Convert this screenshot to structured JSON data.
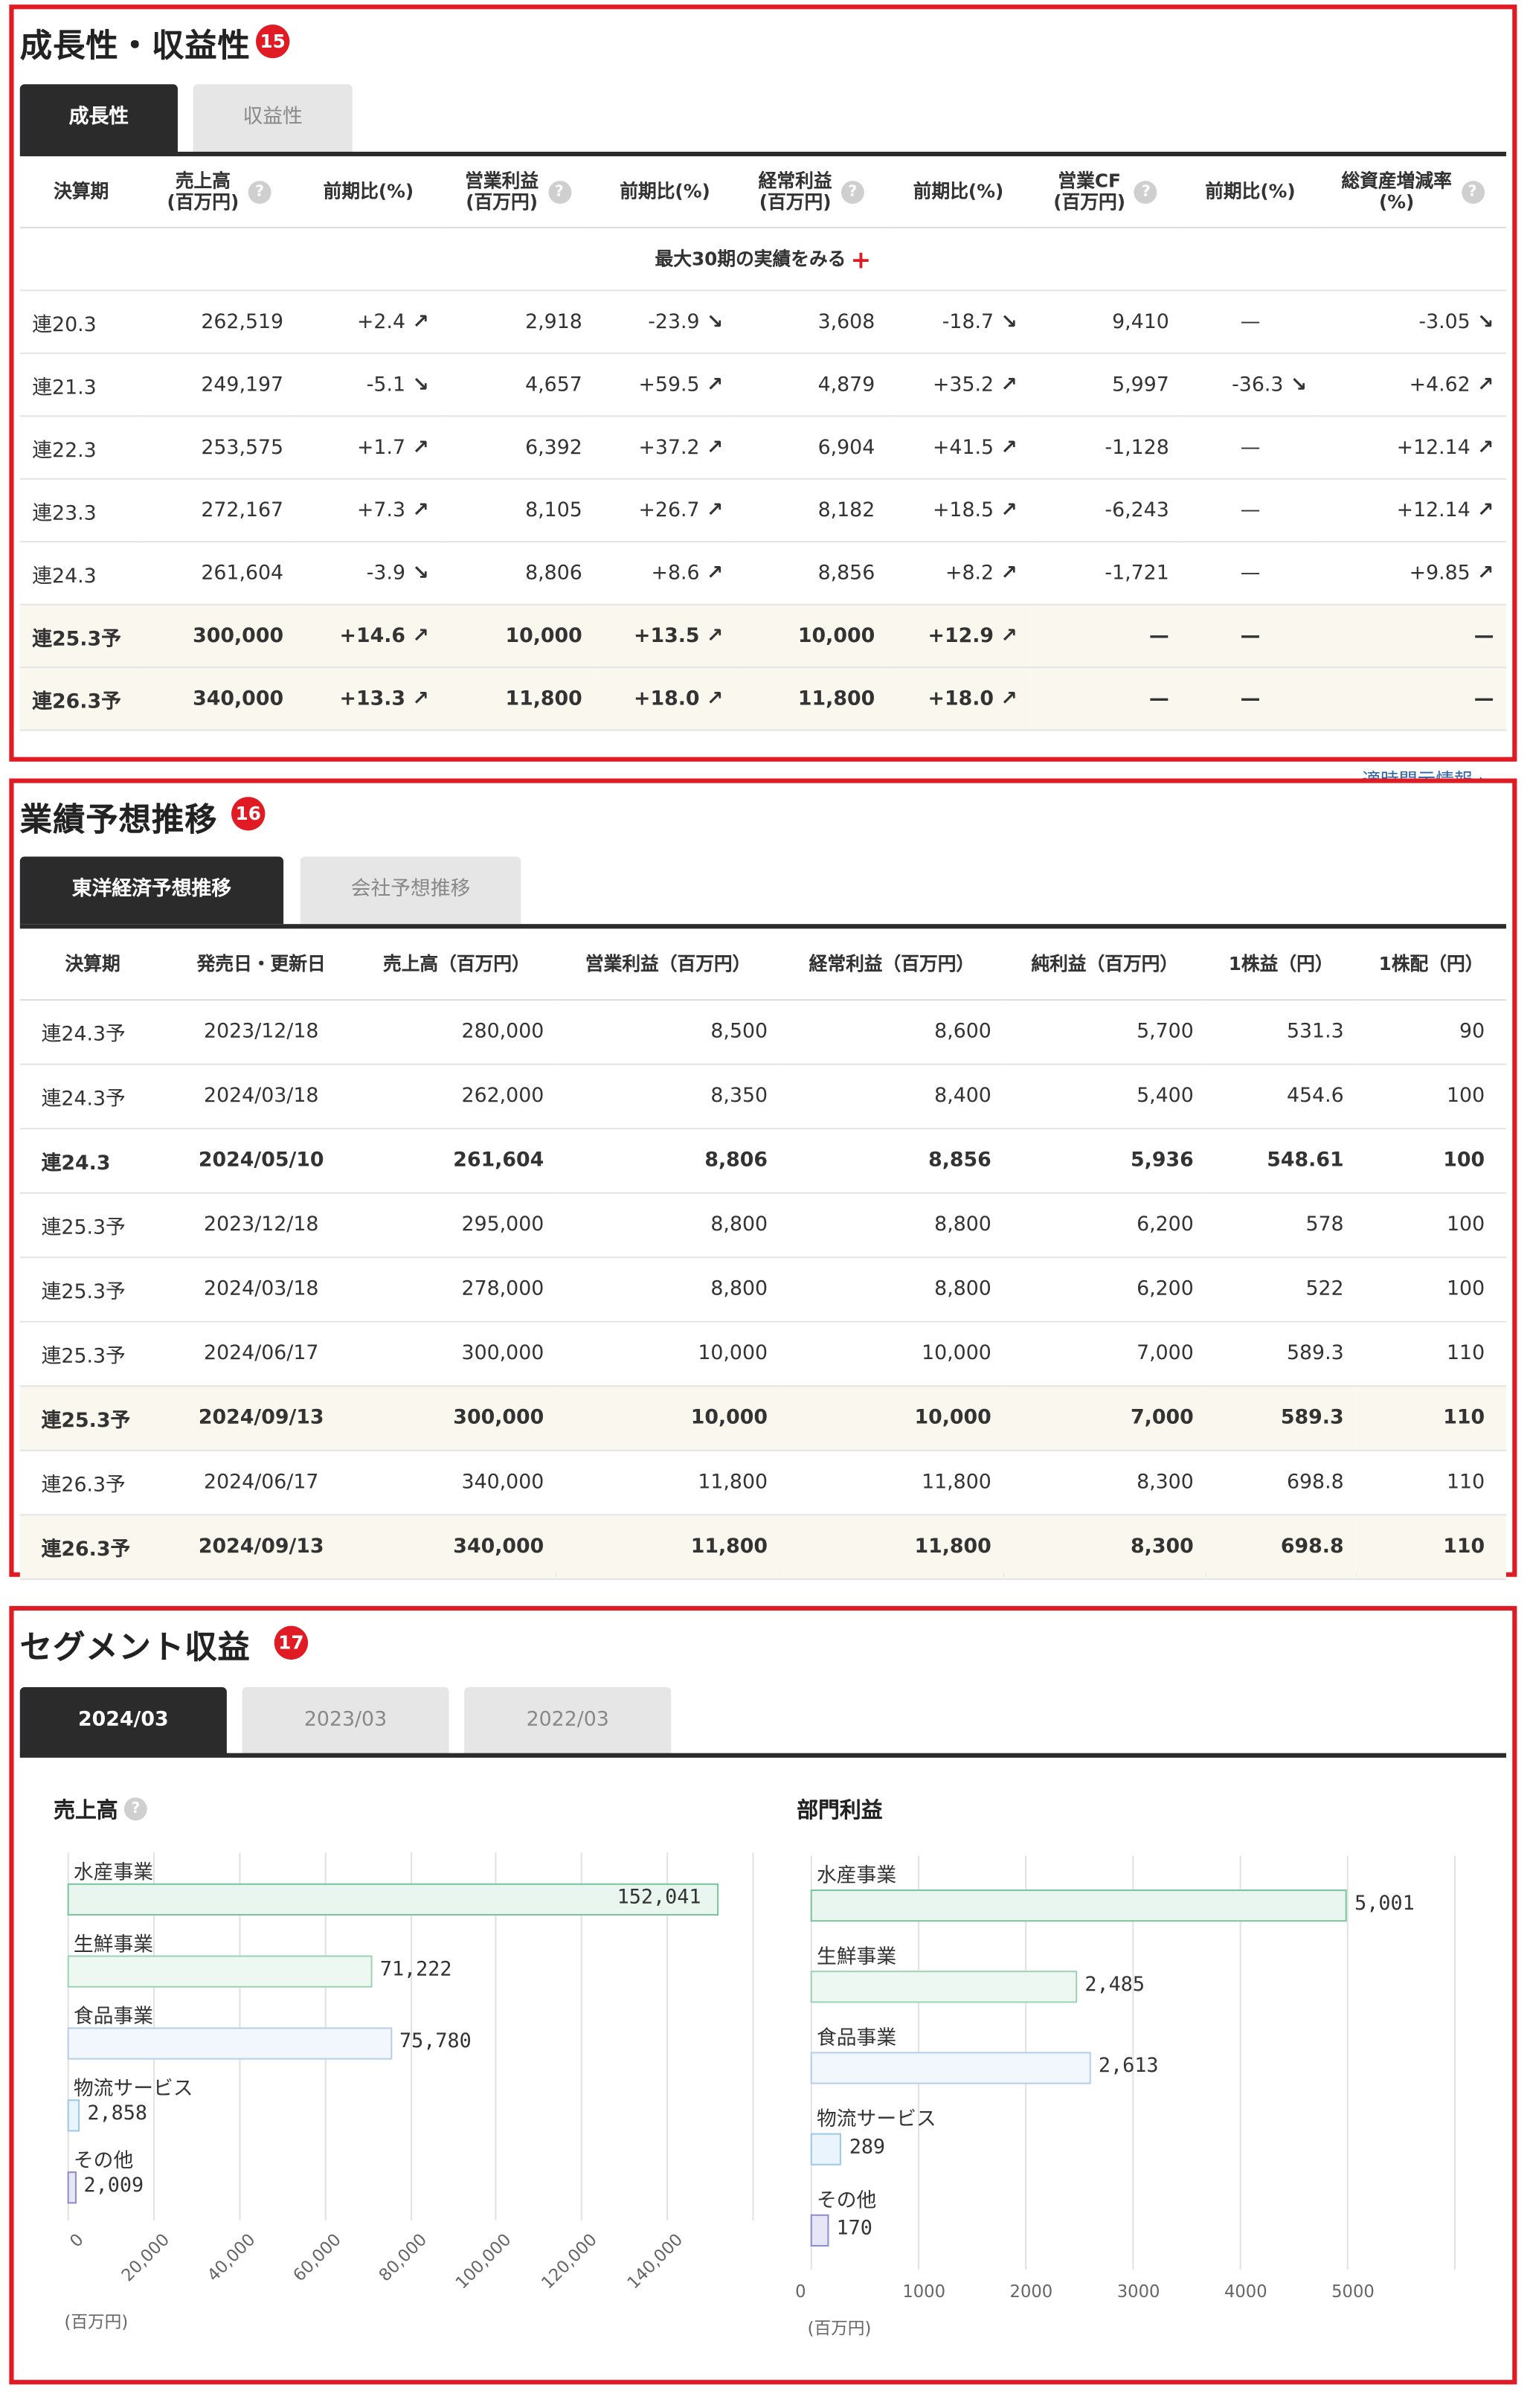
{
  "growth": {
    "title": "成長性・収益性",
    "badge": "15",
    "tabs": [
      "成長性",
      "収益性"
    ],
    "headers": [
      "決算期",
      "売上高\n(百万円)",
      "前期比(%)",
      "営業利益\n(百万円)",
      "前期比(%)",
      "経常利益\n(百万円)",
      "前期比(%)",
      "営業CF\n(百万円)",
      "前期比(%)",
      "総資産増減率\n(%)"
    ],
    "more_label": "最大30期の実績をみる",
    "rows": [
      {
        "period": "連20.3",
        "sales": "262,519",
        "sales_chg": "+2.4",
        "op": "2,918",
        "op_chg": "-23.9",
        "ord": "3,608",
        "ord_chg": "-18.7",
        "cf": "9,410",
        "cf_chg": "—",
        "asset": "-3.05"
      },
      {
        "period": "連21.3",
        "sales": "249,197",
        "sales_chg": "-5.1",
        "op": "4,657",
        "op_chg": "+59.5",
        "ord": "4,879",
        "ord_chg": "+35.2",
        "cf": "5,997",
        "cf_chg": "-36.3",
        "asset": "+4.62"
      },
      {
        "period": "連22.3",
        "sales": "253,575",
        "sales_chg": "+1.7",
        "op": "6,392",
        "op_chg": "+37.2",
        "ord": "6,904",
        "ord_chg": "+41.5",
        "cf": "-1,128",
        "cf_chg": "—",
        "asset": "+12.14"
      },
      {
        "period": "連23.3",
        "sales": "272,167",
        "sales_chg": "+7.3",
        "op": "8,105",
        "op_chg": "+26.7",
        "ord": "8,182",
        "ord_chg": "+18.5",
        "cf": "-6,243",
        "cf_chg": "—",
        "asset": "+12.14"
      },
      {
        "period": "連24.3",
        "sales": "261,604",
        "sales_chg": "-3.9",
        "op": "8,806",
        "op_chg": "+8.6",
        "ord": "8,856",
        "ord_chg": "+8.2",
        "cf": "-1,721",
        "cf_chg": "—",
        "asset": "+9.85"
      },
      {
        "period": "連25.3予",
        "sales": "300,000",
        "sales_chg": "+14.6",
        "op": "10,000",
        "op_chg": "+13.5",
        "ord": "10,000",
        "ord_chg": "+12.9",
        "cf": "—",
        "cf_chg": "—",
        "asset": "—",
        "bold": true
      },
      {
        "period": "連26.3予",
        "sales": "340,000",
        "sales_chg": "+13.3",
        "op": "11,800",
        "op_chg": "+18.0",
        "ord": "11,800",
        "ord_chg": "+18.0",
        "cf": "—",
        "cf_chg": "—",
        "asset": "—",
        "bold": true
      }
    ],
    "disclosure_link": "適時開示情報 ›"
  },
  "forecast": {
    "title": "業績予想推移",
    "badge": "16",
    "tabs": [
      "東洋経済予想推移",
      "会社予想推移"
    ],
    "headers": [
      "決算期",
      "発売日・更新日",
      "売上高（百万円）",
      "営業利益（百万円）",
      "経常利益（百万円）",
      "純利益（百万円）",
      "1株益（円）",
      "1株配（円）"
    ],
    "rows": [
      {
        "period": "連24.3予",
        "date": "2023/12/18",
        "sales": "280,000",
        "op": "8,500",
        "ord": "8,600",
        "net": "5,700",
        "eps": "531.3",
        "div": "90"
      },
      {
        "period": "連24.3予",
        "date": "2024/03/18",
        "sales": "262,000",
        "op": "8,350",
        "ord": "8,400",
        "net": "5,400",
        "eps": "454.6",
        "div": "100"
      },
      {
        "period": "連24.3",
        "date": "2024/05/10",
        "sales": "261,604",
        "op": "8,806",
        "ord": "8,856",
        "net": "5,936",
        "eps": "548.61",
        "div": "100",
        "bold": true,
        "shade": false
      },
      {
        "period": "連25.3予",
        "date": "2023/12/18",
        "sales": "295,000",
        "op": "8,800",
        "ord": "8,800",
        "net": "6,200",
        "eps": "578",
        "div": "100"
      },
      {
        "period": "連25.3予",
        "date": "2024/03/18",
        "sales": "278,000",
        "op": "8,800",
        "ord": "8,800",
        "net": "6,200",
        "eps": "522",
        "div": "100"
      },
      {
        "period": "連25.3予",
        "date": "2024/06/17",
        "sales": "300,000",
        "op": "10,000",
        "ord": "10,000",
        "net": "7,000",
        "eps": "589.3",
        "div": "110"
      },
      {
        "period": "連25.3予",
        "date": "2024/09/13",
        "sales": "300,000",
        "op": "10,000",
        "ord": "10,000",
        "net": "7,000",
        "eps": "589.3",
        "div": "110",
        "bold": true,
        "shade": true
      },
      {
        "period": "連26.3予",
        "date": "2024/06/17",
        "sales": "340,000",
        "op": "11,800",
        "ord": "11,800",
        "net": "8,300",
        "eps": "698.8",
        "div": "110"
      },
      {
        "period": "連26.3予",
        "date": "2024/09/13",
        "sales": "340,000",
        "op": "11,800",
        "ord": "11,800",
        "net": "8,300",
        "eps": "698.8",
        "div": "110",
        "bold": true,
        "shade": true
      }
    ]
  },
  "segment": {
    "title": "セグメント収益",
    "badge": "17",
    "tabs": [
      "2024/03",
      "2023/03",
      "2022/03"
    ],
    "unit": "(百万円)",
    "colors": [
      "#e9f6ef",
      "#eef8f2",
      "#f2f7fd",
      "#e9f4fc",
      "#e6e6f6"
    ],
    "borders": [
      "#7cc5a0",
      "#9fd3b5",
      "#b7cfe8",
      "#9ec9e8",
      "#8e8ecf"
    ]
  },
  "chart_data": [
    {
      "type": "bar",
      "title": "売上高",
      "categories": [
        "水産事業",
        "生鮮事業",
        "食品事業",
        "物流サービス",
        "その他"
      ],
      "values": [
        152041,
        71222,
        75780,
        2858,
        2009
      ],
      "value_labels": [
        "152,041",
        "71,222",
        "75,780",
        "2,858",
        "2,009"
      ],
      "ticks": [
        "0",
        "20,000",
        "40,000",
        "60,000",
        "80,000",
        "100,000",
        "120,000",
        "140,000"
      ],
      "xlim": [
        0,
        160000
      ],
      "orientation": "horizontal"
    },
    {
      "type": "bar",
      "title": "部門利益",
      "categories": [
        "水産事業",
        "生鮮事業",
        "食品事業",
        "物流サービス",
        "その他"
      ],
      "values": [
        5001,
        2485,
        2613,
        289,
        170
      ],
      "value_labels": [
        "5,001",
        "2,485",
        "2,613",
        "289",
        "170"
      ],
      "ticks": [
        "0",
        "1000",
        "2000",
        "3000",
        "4000",
        "5000"
      ],
      "xlim": [
        0,
        6000
      ],
      "orientation": "horizontal"
    }
  ]
}
